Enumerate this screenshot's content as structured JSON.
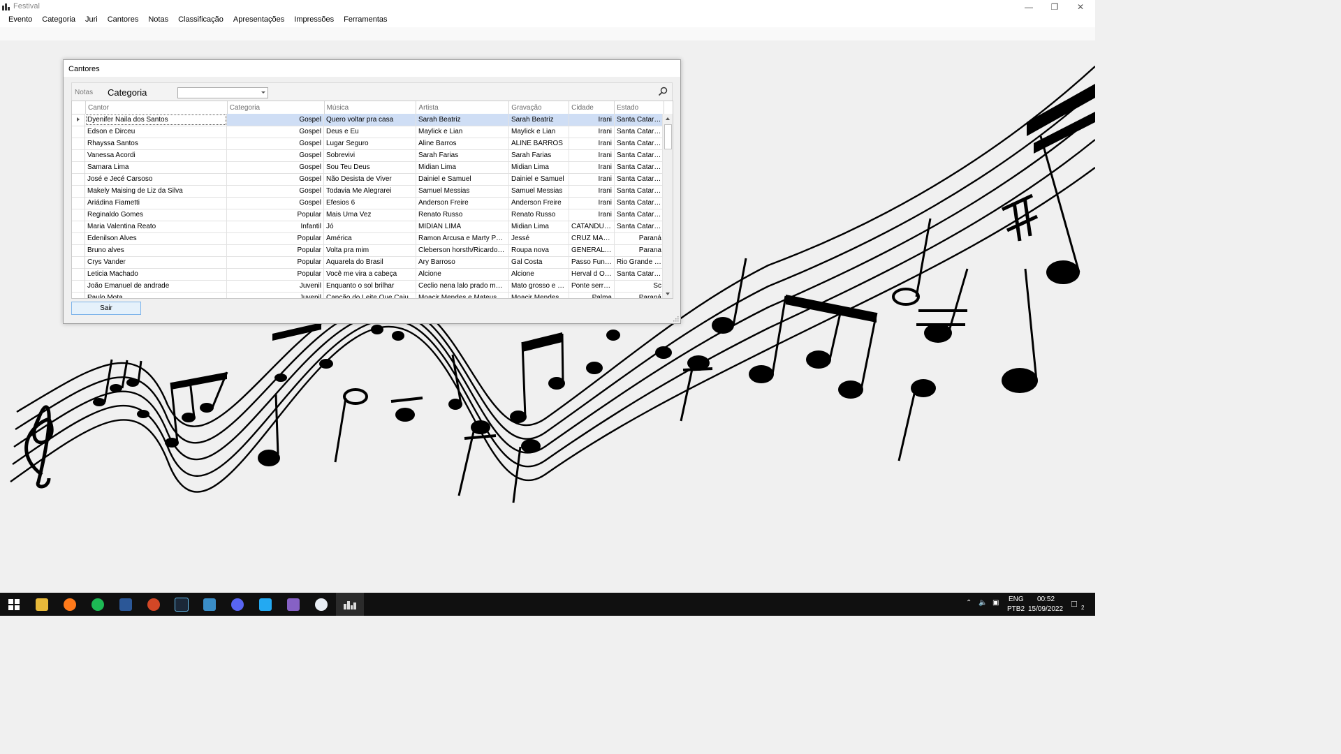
{
  "window": {
    "title": "Festival"
  },
  "menu": [
    "Evento",
    "Categoria",
    "Juri",
    "Cantores",
    "Notas",
    "Classificação",
    "Apresentações",
    "Impressões",
    "Ferramentas"
  ],
  "dialog": {
    "title": "Cantores",
    "toolbar": {
      "notas": "Notas",
      "categoria": "Categoria",
      "combo_value": ""
    },
    "columns": [
      "Cantor",
      "Categoria",
      "Música",
      "Artista",
      "Gravação",
      "Cidade",
      "Estado"
    ],
    "rows": [
      [
        "Dyenifer Naila dos Santos",
        "Gospel",
        "Quero voltar pra casa",
        "Sarah Beatriz",
        "Sarah Beatriz",
        "Irani",
        "Santa Catarina"
      ],
      [
        "Edson e Dirceu",
        "Gospel",
        "Deus e Eu",
        "Maylick e Lian",
        "Maylick e Lian",
        "Irani",
        "Santa Catarina"
      ],
      [
        "Rhayssa Santos",
        "Gospel",
        "Lugar Seguro",
        "Aline Barros",
        "ALINE BARROS",
        "Irani",
        "Santa Catarina"
      ],
      [
        "Vanessa Acordi",
        "Gospel",
        "Sobrevivi",
        "Sarah Farias",
        "Sarah Farias",
        "Irani",
        "Santa Catarina"
      ],
      [
        "Samara Lima",
        "Gospel",
        "Sou Teu Deus",
        "Midian Lima",
        "Midian Lima",
        "Irani",
        "Santa Catarina"
      ],
      [
        "José e Jecé Carsoso",
        "Gospel",
        "Não Desista de Viver",
        "Dainiel e Samuel",
        "Dainiel e Samuel",
        "Irani",
        "Santa Catarina"
      ],
      [
        "Makely Maising de Liz da Silva",
        "Gospel",
        "Todavia Me Alegrarei",
        "Samuel Messias",
        "Samuel Messias",
        "Irani",
        "Santa Catarina"
      ],
      [
        "Ariádina Fiametti",
        "Gospel",
        "Efesios 6",
        "Anderson Freire",
        "Anderson Freire",
        "Irani",
        "Santa Catarina"
      ],
      [
        "Reginaldo Gomes",
        "Popular",
        "Mais Uma Vez",
        "Renato Russo",
        "Renato Russo",
        "Irani",
        "Santa Catarina"
      ],
      [
        "Maria Valentina Reato",
        "Infantil",
        "Jó",
        "MIDIAN LIMA",
        "Midian Lima",
        "CATANDUVAS",
        "Santa Catarina"
      ],
      [
        "Edenilson Alves",
        "Popular",
        "América",
        "Ramon Arcusa e Marty Panzer...",
        "Jessé",
        "CRUZ MACH...",
        "Paraná"
      ],
      [
        "Bruno alves",
        "Popular",
        "Volta pra mim",
        "Cleberson horsth/Ricardo feg...",
        "Roupa nova",
        "GENERAL CA...",
        "Parana"
      ],
      [
        "Crys Vander",
        "Popular",
        "Aquarela do Brasil",
        "Ary Barroso",
        "Gal Costa",
        "Passo Fundo",
        "Rio Grande do..."
      ],
      [
        "Leticia Machado",
        "Popular",
        "Você me vira a cabeça",
        "Alcione",
        "Alcione",
        "Herval d Oeste",
        "Santa Catarina"
      ],
      [
        "João Emanuel de andrade",
        "Juvenil",
        "Enquanto o sol brilhar",
        "Ceclio nena lalo prado mato g...",
        "Mato grosso e ma...",
        "Ponte serrada",
        "Sc"
      ],
      [
        "Paulo Mota",
        "Juvenil",
        "Canção do Leite Que Caiu",
        "Moacir Mendes e Mateus M...",
        "Moacir Mendes",
        "Palma",
        "Paraná"
      ]
    ],
    "sair_label": "Sair"
  },
  "taskbar": {
    "icons": [
      "windows-start-icon",
      "file-explorer-icon",
      "firefox-icon",
      "spotify-icon",
      "word-icon",
      "powerpoint-icon",
      "steam-icon",
      "notepad-icon",
      "discord-icon",
      "vscode-icon",
      "visual-studio-icon",
      "wps-icon",
      "festival-app-icon"
    ],
    "lang": "ENG",
    "layout": "PTB2",
    "time": "00:52",
    "date": "15/09/2022",
    "notification_count": "2"
  },
  "colors": {
    "selection": "#cfdef5",
    "taskbar": "#101010",
    "button": "#e5f1fb"
  }
}
